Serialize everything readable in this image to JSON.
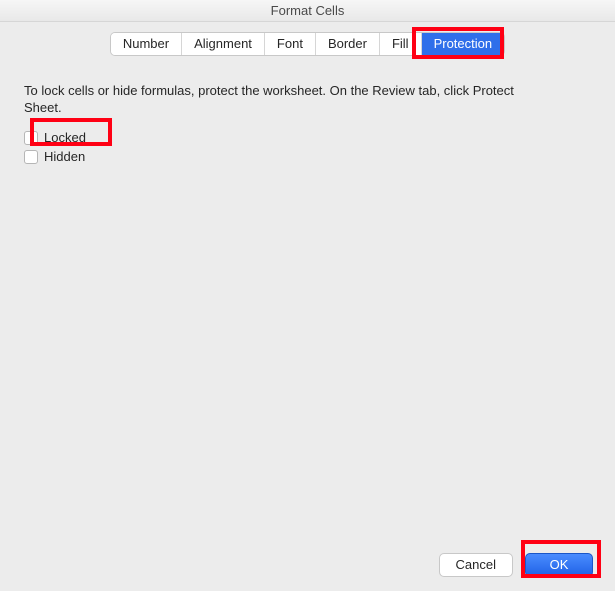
{
  "window": {
    "title": "Format Cells"
  },
  "tabs": {
    "number": "Number",
    "alignment": "Alignment",
    "font": "Font",
    "border": "Border",
    "fill": "Fill",
    "protection": "Protection",
    "active": "protection"
  },
  "protection": {
    "description": "To lock cells or hide formulas, protect the worksheet. On the Review tab, click Protect Sheet.",
    "locked_label": "Locked",
    "hidden_label": "Hidden",
    "locked_checked": false,
    "hidden_checked": false
  },
  "buttons": {
    "cancel": "Cancel",
    "ok": "OK"
  },
  "annotations": {
    "highlight_protection_tab": true,
    "highlight_locked_checkbox": true,
    "highlight_ok_button": true
  }
}
